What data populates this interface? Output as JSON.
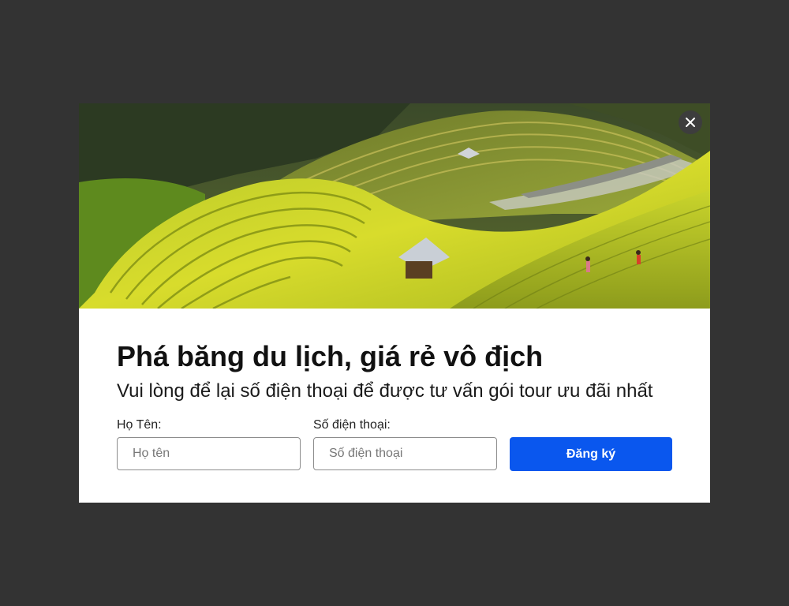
{
  "popup": {
    "title": "Phá băng du lịch, giá rẻ vô địch",
    "subtitle": "Vui lòng để lại số điện thoại để được tư vấn gói tour ưu đãi nhất",
    "close_icon": "close-icon",
    "hero_image": "rice-terraces-photo"
  },
  "form": {
    "name_label": "Họ Tên:",
    "name_placeholder": "Họ tên",
    "name_value": "",
    "phone_label": "Số điện thoại:",
    "phone_placeholder": "Số điện thoại",
    "phone_value": "",
    "submit_label": "Đăng ký"
  },
  "colors": {
    "backdrop": "#333333",
    "modal_bg": "#ffffff",
    "button_bg": "#0a57ee",
    "close_bg": "#3d3d3d"
  }
}
